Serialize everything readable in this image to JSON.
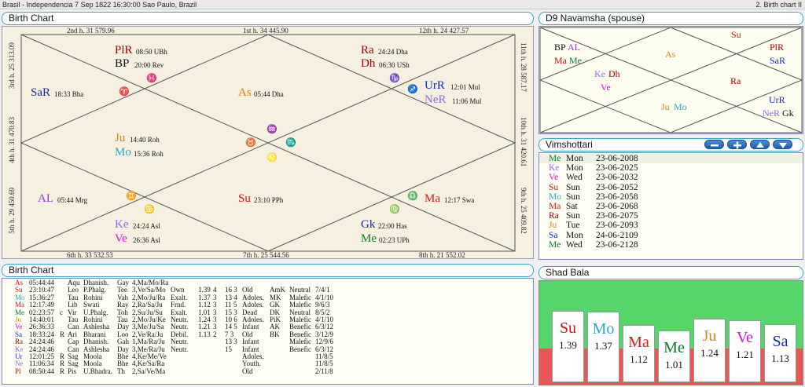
{
  "window": {
    "title": "Brasil - Independencia 7 Sep 1822 16:30:00  Sao Paulo, Brazil",
    "right_title": "2. Birth chart II"
  },
  "birth_chart_panel": {
    "title": "Birth Chart",
    "house_labels": {
      "h1": "1st h.  34  445.90",
      "h2": "2nd h.  31  579.96",
      "h12": "12th h.  24  427.57",
      "h3": "3rd h.  25  313.09",
      "h4": "4th h.  31  470.83",
      "h5": "5th h.  29  450.69",
      "h6": "6th h.  33  532.53",
      "h7": "7th h.  25  544.56",
      "h8": "8th h.  21  552.02",
      "h9": "9th h.  25  409.82",
      "h10": "10th h.  31  420.61",
      "h11": "11th h.  28  587.17"
    },
    "planets": {
      "plr": {
        "name": "PlR",
        "deg": "08:50 UBh"
      },
      "bp": {
        "name": "BP",
        "deg": "20:00 Rev"
      },
      "ra": {
        "name": "Ra",
        "deg": "24:24 Dha"
      },
      "dh": {
        "name": "Dh",
        "deg": "06:30 USh"
      },
      "sar": {
        "name": "SaR",
        "deg": "18:33 Bha"
      },
      "as": {
        "name": "As",
        "deg": "05:44 Dha"
      },
      "urr": {
        "name": "UrR",
        "deg": "12:01 Mul"
      },
      "ner": {
        "name": "NeR",
        "deg": "11:06 Mul"
      },
      "ju": {
        "name": "Ju",
        "deg": "14:40 Roh"
      },
      "mo": {
        "name": "Mo",
        "deg": "15:36 Roh"
      },
      "al": {
        "name": "AL",
        "deg": "05:44 Mrg"
      },
      "su": {
        "name": "Su",
        "deg": "23:10 PPh"
      },
      "ma": {
        "name": "Ma",
        "deg": "12:17 Swa"
      },
      "ke": {
        "name": "Ke",
        "deg": "24:24 Asl"
      },
      "ve": {
        "name": "Ve",
        "deg": "26:36 Asl"
      },
      "gk": {
        "name": "Gk",
        "deg": "22:00 Has"
      },
      "me": {
        "name": "Me",
        "deg": "02:23 UPh"
      }
    },
    "signs": {
      "pisces": "♓",
      "aries": "♈",
      "capricorn": "♑",
      "aquarius": "♒",
      "taurus": "♉",
      "scorpio": "♏",
      "leo": "♌",
      "gemini": "♊",
      "cancer": "♋",
      "libra": "♎",
      "virgo": "♍",
      "sagittarius": "♐"
    }
  },
  "navamsha_panel": {
    "title": "D9 Navamsha  (spouse)",
    "items": {
      "su": "Su",
      "bp": "BP",
      "al": "AL",
      "ma": "Ma",
      "me": "Me",
      "as": "As",
      "plr": "PlR",
      "sar": "SaR",
      "ke": "Ke",
      "dh": "Dh",
      "ve": "Ve",
      "ra": "Ra",
      "ju": "Ju",
      "mo": "Mo",
      "urr": "UrR",
      "ner": "NeR",
      "gk": "Gk"
    }
  },
  "vimshottari_panel": {
    "title": "Vimshottari",
    "buttons": {
      "minus": "−",
      "plus": "+",
      "up": "▲",
      "down": "▼"
    },
    "rows": [
      {
        "lord": "Me",
        "day": "Mon",
        "date": "23-06-2008",
        "color": "#0a7a2a"
      },
      {
        "lord": "Ke",
        "day": "Mon",
        "date": "23-06-2025",
        "color": "#8a6af0"
      },
      {
        "lord": "Ve",
        "day": "Wed",
        "date": "23-06-2032",
        "color": "#e010d8"
      },
      {
        "lord": "Su",
        "day": "Sun",
        "date": "23-06-2052",
        "color": "#c81010"
      },
      {
        "lord": "Mo",
        "day": "Sun",
        "date": "23-06-2058",
        "color": "#2aa6c8"
      },
      {
        "lord": "Ma",
        "day": "Sat",
        "date": "23-06-2068",
        "color": "#d81a1a"
      },
      {
        "lord": "Ra",
        "day": "Sun",
        "date": "23-06-2075",
        "color": "#a00000"
      },
      {
        "lord": "Ju",
        "day": "Tue",
        "date": "23-06-2093",
        "color": "#e08010"
      },
      {
        "lord": "Sa",
        "day": "Mon",
        "date": "24-06-2109",
        "color": "#1428b4"
      },
      {
        "lord": "Me",
        "day": "Wed",
        "date": "23-06-2128",
        "color": "#0a7a2a"
      }
    ]
  },
  "table_panel": {
    "title": "Birth Chart",
    "rows": [
      {
        "p": "As",
        "c": "#c81010",
        "t": "05:44:44",
        "r": "",
        "s": "Aqu",
        "n": "Dhanish.",
        "g": "Gay",
        "l": "4,Ma/Mo/Ra",
        "dg": "",
        "sb": "",
        "h": "",
        "a": "",
        "age": "",
        "ak": "",
        "nat": "",
        "x": ""
      },
      {
        "p": "Su",
        "c": "#c81010",
        "t": "23:10:47",
        "r": "",
        "s": "Leo",
        "n": "P.Phalg.",
        "g": "Tee",
        "l": "3,Ve/Sa/Mo",
        "dg": "Own",
        "sb": "1.39",
        "h": "4",
        "a": "16  3",
        "age": "Old",
        "ak": "AmK",
        "nat": "Neutral",
        "x": "7/4/1"
      },
      {
        "p": "Mo",
        "c": "#2aa6c8",
        "t": "15:36:27",
        "r": "",
        "s": "Tau",
        "n": "Rohini",
        "g": "Vah",
        "l": "2,Mo/Ju/Ra",
        "dg": "Exalt.",
        "sb": "1.37",
        "h": "3",
        "a": "13  4",
        "age": "Adoles.",
        "ak": "MK",
        "nat": "Malefic",
        "x": "4/1/10"
      },
      {
        "p": "Ma",
        "c": "#d81a1a",
        "t": "12:17:49",
        "r": "",
        "s": "Lib",
        "n": "Swati",
        "g": "Ray",
        "l": "2,Ra/Sa/Ju",
        "dg": "Frnd.",
        "sb": "1.12",
        "h": "3",
        "a": "11  5",
        "age": "Adoles.",
        "ak": "GK",
        "nat": "Malefic",
        "x": "9/6/3"
      },
      {
        "p": "Me",
        "c": "#0a7a2a",
        "t": "02:23:57",
        "r": "c",
        "s": "Vir",
        "n": "U.Phalg.",
        "g": "Toh",
        "l": "2,Su/Ju/Su",
        "dg": "Exalt.",
        "sb": "1.01",
        "h": "3",
        "a": "15  3",
        "age": "Dead",
        "ak": "DK",
        "nat": "Neutral",
        "x": "8/5/2"
      },
      {
        "p": "Ju",
        "c": "#e08010",
        "t": "14:40:01",
        "r": "",
        "s": "Tau",
        "n": "Rohini",
        "g": "Tau",
        "l": "2,Mo/Ju/Ke",
        "dg": "Neutr.",
        "sb": "1.24",
        "h": "3",
        "a": "10  6",
        "age": "Adoles.",
        "ak": "PiK",
        "nat": "Malefic",
        "x": "4/1/10"
      },
      {
        "p": "Ve",
        "c": "#e010d8",
        "t": "26:36:33",
        "r": "",
        "s": "Can",
        "n": "Ashlesha",
        "g": "Day",
        "l": "3,Me/Ju/Sa",
        "dg": "Neutr.",
        "sb": "1.21",
        "h": "3",
        "a": "14  5",
        "age": "Infant",
        "ak": "AK",
        "nat": "Benefic",
        "x": "6/3/12"
      },
      {
        "p": "Sa",
        "c": "#1428b4",
        "t": "18:33:24",
        "r": "R",
        "s": "Ari",
        "n": "Bharani",
        "g": "Loo",
        "l": "2,Ve/Ra/Ju",
        "dg": "Debil.",
        "sb": "1.13",
        "h": "2",
        "a": "7   3",
        "age": "Old",
        "ak": "BK",
        "nat": "Benefic",
        "x": "3/12/9"
      },
      {
        "p": "Ra",
        "c": "#a00000",
        "t": "24:24:46",
        "r": "",
        "s": "Cap",
        "n": "Dhanish.",
        "g": "Gah",
        "l": "1,Ma/Ra/Ju",
        "dg": "Neutr.",
        "sb": "",
        "h": "",
        "a": "13  3",
        "age": "Infant",
        "ak": "",
        "nat": "Malefic",
        "x": "12/9/6"
      },
      {
        "p": "Ke",
        "c": "#8a6af0",
        "t": "24:24:46",
        "r": "",
        "s": "Can",
        "n": "Ashlesha",
        "g": "Day",
        "l": "3,Me/Ra/Ju",
        "dg": "Neutr.",
        "sb": "",
        "h": "",
        "a": "15",
        "age": "Infant",
        "ak": "",
        "nat": "Benefic",
        "x": "6/3/12"
      },
      {
        "p": "Ur",
        "c": "#1428b4",
        "t": "12:01:25",
        "r": "R",
        "s": "Sag",
        "n": "Moola",
        "g": "Bhe",
        "l": "4,Ke/Me/Ve",
        "dg": "",
        "sb": "",
        "h": "",
        "a": "",
        "age": "Adoles.",
        "ak": "",
        "nat": "",
        "x": "11/8/5"
      },
      {
        "p": "Ne",
        "c": "#8a6af0",
        "t": "11:06:34",
        "r": "R",
        "s": "Sag",
        "n": "Moola",
        "g": "Bhe",
        "l": "4,Ke/Sa/Ra",
        "dg": "",
        "sb": "",
        "h": "",
        "a": "",
        "age": "Youth.",
        "ak": "",
        "nat": "",
        "x": "11/8/5"
      },
      {
        "p": "Pl",
        "c": "#c81010",
        "t": "08:50:44",
        "r": "R",
        "s": "Pis",
        "n": "U.Bhadra.",
        "g": "Th",
        "l": "2,Sa/Ve/Ma",
        "dg": "",
        "sb": "",
        "h": "",
        "a": "",
        "age": "Old",
        "ak": "",
        "nat": "",
        "x": "2/11/8"
      }
    ]
  },
  "shadbala_panel": {
    "title": "Shad Bala",
    "colors": {
      "top": "#56d66a",
      "bottom": "#ea5656",
      "threshold_fraction": 0.65
    },
    "bars": [
      {
        "name": "Su",
        "value": "1.39",
        "v": 1.39,
        "color": "#c81010"
      },
      {
        "name": "Mo",
        "value": "1.37",
        "v": 1.37,
        "color": "#2aa6c8"
      },
      {
        "name": "Ma",
        "value": "1.12",
        "v": 1.12,
        "color": "#d81a1a"
      },
      {
        "name": "Me",
        "value": "1.01",
        "v": 1.01,
        "color": "#0a7a2a"
      },
      {
        "name": "Ju",
        "value": "1.24",
        "v": 1.24,
        "color": "#e08010"
      },
      {
        "name": "Ve",
        "value": "1.21",
        "v": 1.21,
        "color": "#e010d8"
      },
      {
        "name": "Sa",
        "value": "1.13",
        "v": 1.13,
        "color": "#1428b4"
      }
    ]
  }
}
